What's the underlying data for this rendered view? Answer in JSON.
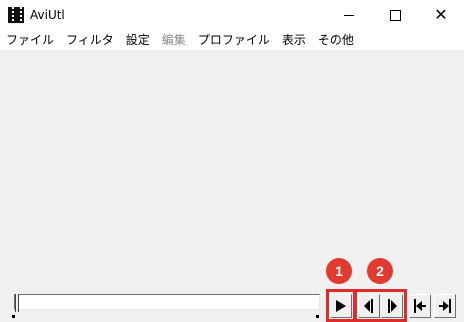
{
  "window": {
    "title": "AviUtl"
  },
  "menu": {
    "items": [
      {
        "label": "ファイル",
        "enabled": true
      },
      {
        "label": "フィルタ",
        "enabled": true
      },
      {
        "label": "設定",
        "enabled": true
      },
      {
        "label": "編集",
        "enabled": false
      },
      {
        "label": "プロファイル",
        "enabled": true
      },
      {
        "label": "表示",
        "enabled": true
      },
      {
        "label": "その他",
        "enabled": true
      }
    ]
  },
  "annotations": {
    "badge1": "1",
    "badge2": "2",
    "accent_color": "#e23a2f"
  },
  "controls": {
    "play_icon": "play-icon",
    "prev_frame_icon": "prev-frame-icon",
    "next_frame_icon": "next-frame-icon",
    "first_frame_icon": "first-frame-icon",
    "last_frame_icon": "last-frame-icon"
  }
}
